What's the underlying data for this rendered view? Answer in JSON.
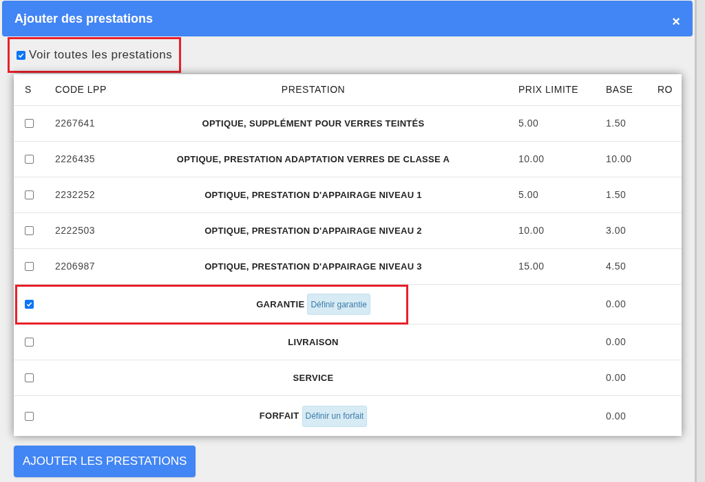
{
  "dialog": {
    "title": "Ajouter des prestations",
    "close": "×"
  },
  "show_all": {
    "label": "Voir toutes les prestations",
    "checked": true,
    "highlighted": true
  },
  "table": {
    "columns": [
      "S",
      "CODE LPP",
      "PRESTATION",
      "PRIX LIMITE",
      "BASE",
      "RO"
    ],
    "rows": [
      {
        "checked": false,
        "highlighted": false,
        "code": "2267641",
        "name": "OPTIQUE, SUPPLÉMENT POUR VERRES TEINTÉS",
        "prix": "5.00",
        "base": "1.50"
      },
      {
        "checked": false,
        "highlighted": false,
        "code": "2226435",
        "name": "OPTIQUE, PRESTATION ADAPTATION VERRES DE CLASSE A",
        "prix": "10.00",
        "base": "10.00"
      },
      {
        "checked": false,
        "highlighted": false,
        "code": "2232252",
        "name": "OPTIQUE, PRESTATION D'APPAIRAGE NIVEAU 1",
        "prix": "5.00",
        "base": "1.50"
      },
      {
        "checked": false,
        "highlighted": false,
        "code": "2222503",
        "name": "OPTIQUE, PRESTATION D'APPAIRAGE NIVEAU 2",
        "prix": "10.00",
        "base": "3.00"
      },
      {
        "checked": false,
        "highlighted": false,
        "code": "2206987",
        "name": "OPTIQUE, PRESTATION D'APPAIRAGE NIVEAU 3",
        "prix": "15.00",
        "base": "4.50"
      },
      {
        "checked": true,
        "highlighted": true,
        "name": "GARANTIE",
        "action": "Définir garantie",
        "base": "0.00"
      },
      {
        "checked": false,
        "highlighted": false,
        "name": "LIVRAISON",
        "base": "0.00"
      },
      {
        "checked": false,
        "highlighted": false,
        "name": "SERVICE",
        "base": "0.00"
      },
      {
        "checked": false,
        "highlighted": false,
        "name": "FORFAIT",
        "action": "Définir un forfait",
        "base": "0.00"
      }
    ]
  },
  "submit": "AJOUTER LES PRESTATIONS"
}
